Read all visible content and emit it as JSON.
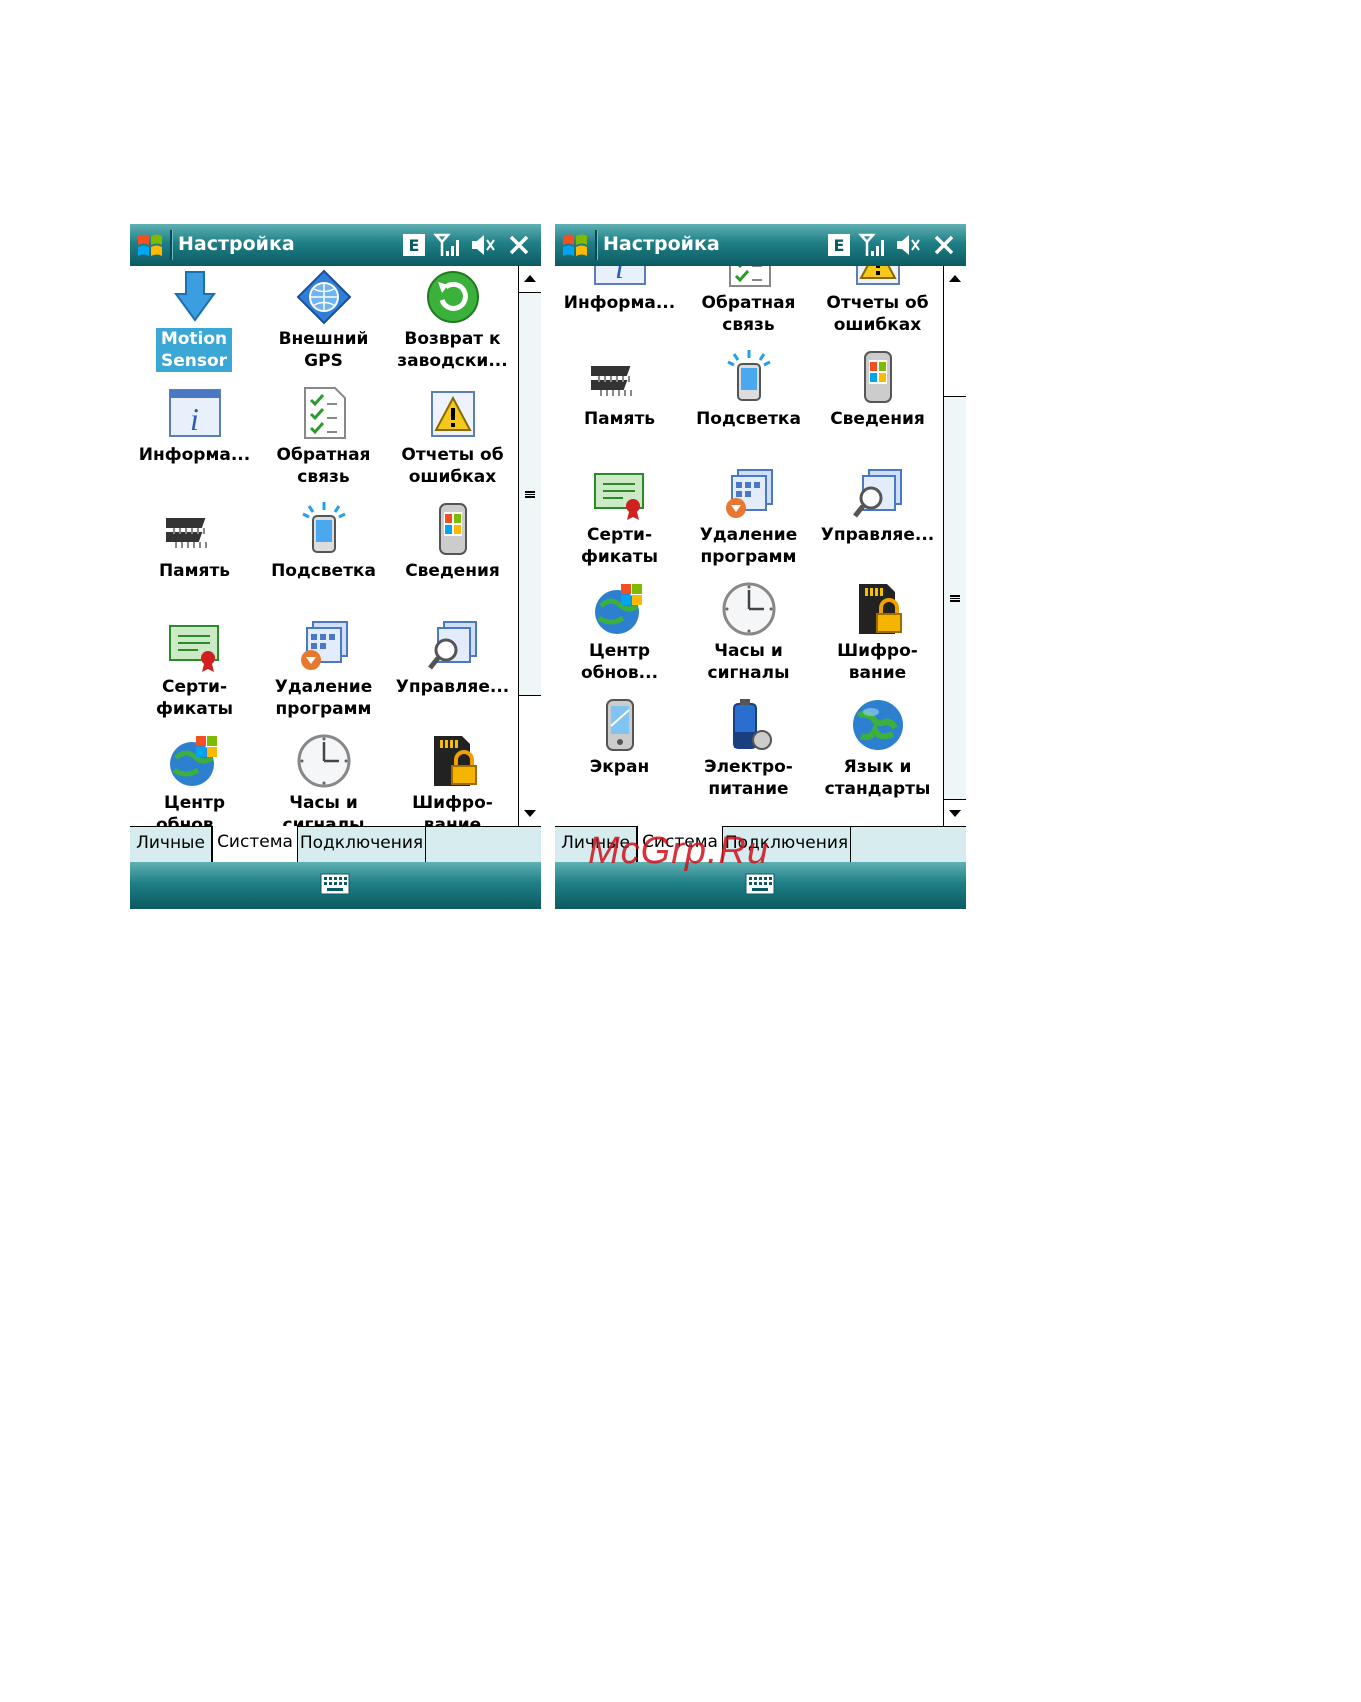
{
  "app": {
    "title": "Настройка",
    "status_input_mode": "E",
    "status_icons": [
      "signal-icon",
      "speaker-mute-icon",
      "close-icon"
    ]
  },
  "tabs": [
    "Личные",
    "Система",
    "Подключения"
  ],
  "active_tab": "Система",
  "screens": [
    {
      "items": [
        {
          "label": "Motion\nSensor",
          "icon": "motion-sensor-icon",
          "selected": true
        },
        {
          "label": "Внешний\nGPS",
          "icon": "gps-globe-icon"
        },
        {
          "label": "Возврат к\nзаводски...",
          "icon": "reset-icon"
        },
        {
          "label": "Информа...",
          "icon": "info-icon"
        },
        {
          "label": "Обратная\nсвязь",
          "icon": "feedback-icon"
        },
        {
          "label": "Отчеты об\nошибках",
          "icon": "error-report-icon"
        },
        {
          "label": "Память",
          "icon": "memory-icon"
        },
        {
          "label": "Подсветка",
          "icon": "backlight-icon"
        },
        {
          "label": "Сведения",
          "icon": "about-icon"
        },
        {
          "label": "Серти-\nфикаты",
          "icon": "certificate-icon"
        },
        {
          "label": "Удаление\nпрограмм",
          "icon": "remove-programs-icon"
        },
        {
          "label": "Управляе...",
          "icon": "managed-programs-icon"
        },
        {
          "label": "Центр\nобнов...",
          "icon": "update-center-icon"
        },
        {
          "label": "Часы и\nсигналы",
          "icon": "clock-icon"
        },
        {
          "label": "Шифро-\nвание",
          "icon": "encryption-icon"
        }
      ]
    },
    {
      "items": [
        {
          "label": "Информа...",
          "icon": "info-icon"
        },
        {
          "label": "Обратная\nсвязь",
          "icon": "feedback-icon"
        },
        {
          "label": "Отчеты об\nошибках",
          "icon": "error-report-icon"
        },
        {
          "label": "Память",
          "icon": "memory-icon"
        },
        {
          "label": "Подсветка",
          "icon": "backlight-icon"
        },
        {
          "label": "Сведения",
          "icon": "about-icon"
        },
        {
          "label": "Серти-\nфикаты",
          "icon": "certificate-icon"
        },
        {
          "label": "Удаление\nпрограмм",
          "icon": "remove-programs-icon"
        },
        {
          "label": "Управляе...",
          "icon": "managed-programs-icon"
        },
        {
          "label": "Центр\nобнов...",
          "icon": "update-center-icon"
        },
        {
          "label": "Часы и\nсигналы",
          "icon": "clock-icon"
        },
        {
          "label": "Шифро-\nвание",
          "icon": "encryption-icon"
        },
        {
          "label": "Экран",
          "icon": "screen-icon"
        },
        {
          "label": "Электро-\nпитание",
          "icon": "power-icon"
        },
        {
          "label": "Язык и\nстандарты",
          "icon": "language-globe-icon"
        }
      ]
    }
  ],
  "watermark": "McGrp.Ru",
  "colors": {
    "titlebar": "#1f7f86",
    "selection": "#3aa7d6",
    "tabbar": "#d6ecee"
  }
}
